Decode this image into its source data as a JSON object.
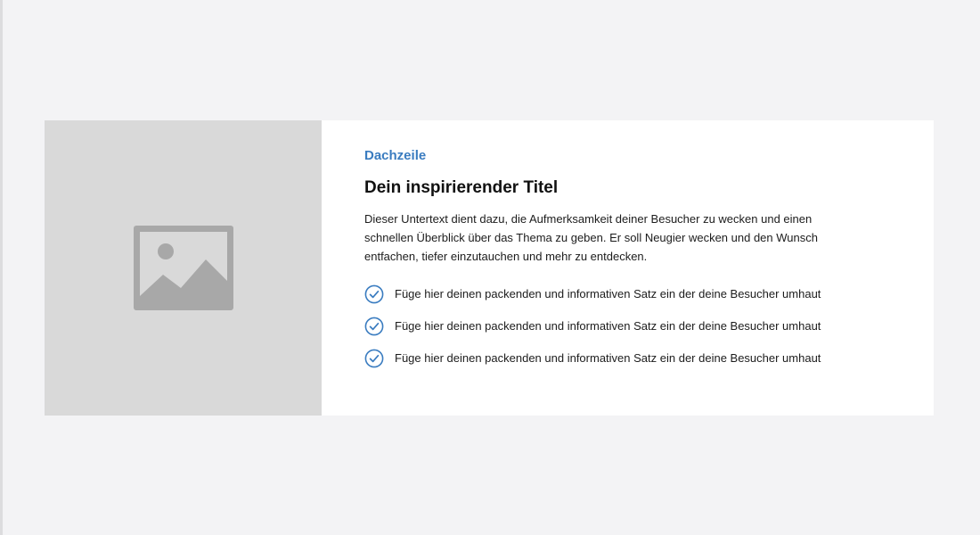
{
  "theme": {
    "accent": "#3a7cc0",
    "page_background": "#f3f3f5",
    "card_background": "#ffffff",
    "placeholder_background": "#d9d9d9",
    "placeholder_icon_color": "#a8a8a8"
  },
  "media": {
    "icon": "image-placeholder-icon"
  },
  "content": {
    "kicker": "Dachzeile",
    "title": "Dein inspirierender Titel",
    "subtext": "Dieser Untertext dient dazu, die Aufmerksamkeit deiner Besucher zu wecken und einen schnellen Überblick über das Thema zu geben. Er soll Neugier wecken und den Wunsch entfachen, tiefer einzutauchen und mehr zu entdecken.",
    "bullets": [
      {
        "icon": "check-circle-icon",
        "text": "Füge hier deinen packenden und informativen Satz ein der deine Besucher umhaut"
      },
      {
        "icon": "check-circle-icon",
        "text": "Füge hier deinen packenden und informativen Satz ein der deine Besucher umhaut"
      },
      {
        "icon": "check-circle-icon",
        "text": "Füge hier deinen packenden und informativen Satz ein der deine Besucher umhaut"
      }
    ]
  }
}
